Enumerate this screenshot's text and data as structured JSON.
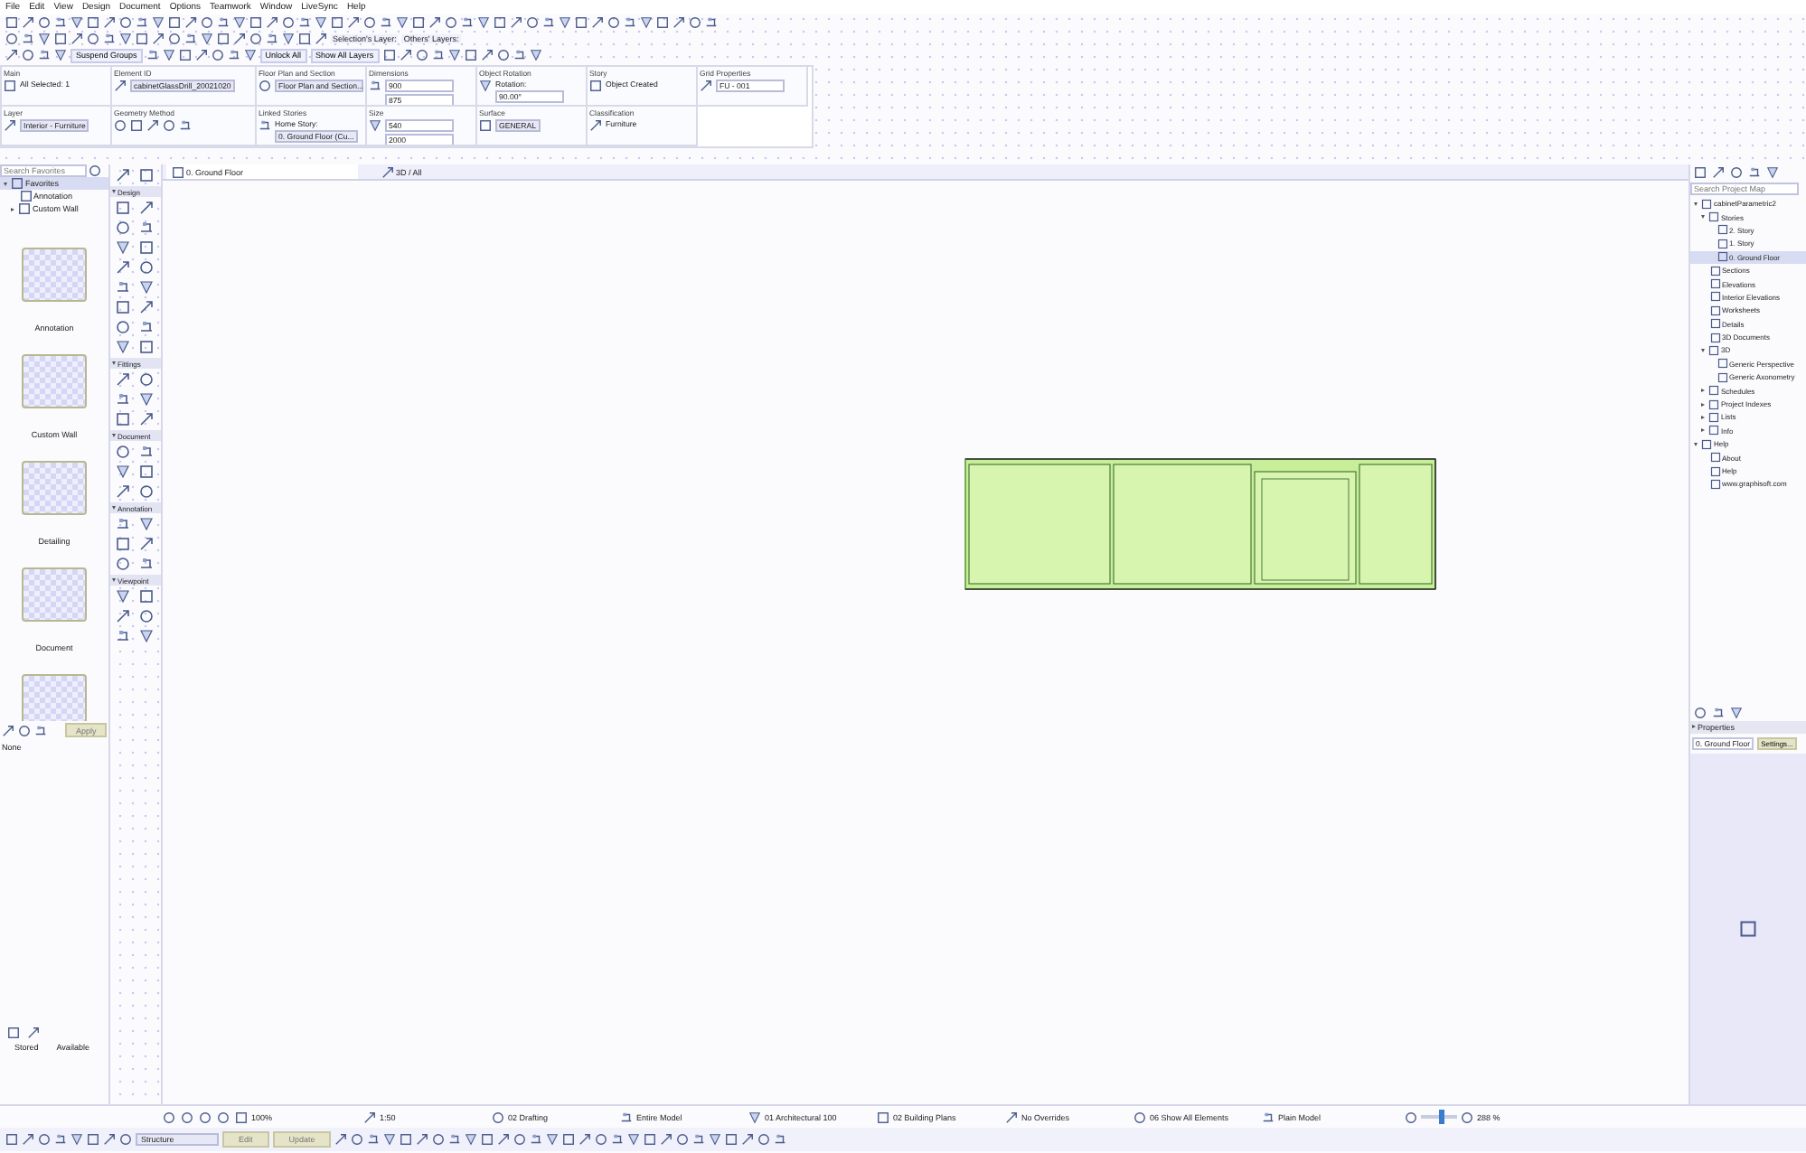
{
  "menu": [
    "File",
    "Edit",
    "View",
    "Design",
    "Document",
    "Options",
    "Teamwork",
    "Window",
    "LiveSync",
    "Help"
  ],
  "toolbar": {
    "selection_layer": "Selection's Layer:",
    "others_layers": "Others' Layers:",
    "suspend_groups": "Suspend Groups",
    "unlock_all": "Unlock All",
    "show_all_layers": "Show All Layers"
  },
  "info_box": {
    "top": [
      {
        "label": "Main",
        "items": [
          {
            "kind": "text",
            "text": "All Selected: 1"
          }
        ]
      },
      {
        "label": "Element ID",
        "items": [
          {
            "kind": "dropdown",
            "text": "cabinetGlassDrill_20021020"
          }
        ]
      },
      {
        "label": "Floor Plan and Section",
        "items": [
          {
            "kind": "dropdown",
            "text": "Floor Plan and Section..."
          }
        ]
      },
      {
        "label": "Dimensions",
        "items": [
          {
            "kind": "input",
            "text": "900"
          },
          {
            "kind": "input",
            "text": "875"
          }
        ]
      },
      {
        "label": "Object Rotation",
        "items": [
          {
            "kind": "text",
            "text": "Rotation:"
          },
          {
            "kind": "input",
            "text": "90.00°"
          }
        ]
      },
      {
        "label": "Story",
        "items": [
          {
            "kind": "text",
            "text": "Object Created"
          }
        ]
      },
      {
        "label": "Grid Properties",
        "items": [
          {
            "kind": "input",
            "text": "FU - 001"
          }
        ]
      }
    ],
    "bottom": [
      {
        "label": "Layer",
        "items": [
          {
            "kind": "dropdown",
            "text": "Interior - Furniture"
          }
        ]
      },
      {
        "label": "Geometry Method"
      },
      {
        "label": "Linked Stories",
        "items": [
          {
            "kind": "text",
            "text": "Home Story:"
          },
          {
            "kind": "dropdown",
            "text": "0. Ground Floor (Cu..."
          }
        ]
      },
      {
        "label": "Size",
        "items": [
          {
            "kind": "input",
            "text": "540"
          },
          {
            "kind": "input",
            "text": "2000"
          }
        ]
      },
      {
        "label": "Surface",
        "items": [
          {
            "kind": "dropdown",
            "text": "GENERAL"
          }
        ]
      },
      {
        "label": "Classification",
        "items": [
          {
            "kind": "text",
            "text": "Furniture"
          }
        ]
      }
    ]
  },
  "favorites": {
    "search": {
      "placeholder": "Search Favorites"
    },
    "tree": [
      {
        "label": "Favorites",
        "expanded": true,
        "selected": true,
        "children": [
          {
            "label": "Annotation",
            "selected": false
          },
          {
            "label": "Custom Wall",
            "expanded": false,
            "selected": false
          }
        ]
      }
    ],
    "previews": [
      {
        "kind": "labeled",
        "label": "Annotation"
      },
      {
        "kind": "labeled",
        "label": "Custom Wall"
      },
      {
        "kind": "labeled",
        "label": "Detailing"
      },
      {
        "kind": "labeled",
        "label": "Document"
      },
      {
        "kind": "unlabeled"
      }
    ],
    "apply": "Apply",
    "none_label": "None",
    "stored": "Stored",
    "available": "Available"
  },
  "toolbox": [
    {
      "title": "Design",
      "expanded": true
    },
    {
      "title": "Fittings",
      "expanded": true
    },
    {
      "title": "Document",
      "expanded": true
    },
    {
      "title": "Annotation",
      "expanded": true
    },
    {
      "title": "Viewpoint",
      "expanded": true
    }
  ],
  "view_tabs": [
    {
      "label": "0. Ground Floor",
      "selected": true
    },
    {
      "label": "3D / All",
      "selected": false
    }
  ],
  "project_map": {
    "search": {
      "placeholder": "Search Project Map"
    },
    "tree": [
      {
        "label": "cabinetParametric2",
        "expanded": true,
        "selected": false,
        "children": [
          {
            "label": "Stories",
            "expanded": true,
            "selected": false,
            "children": [
              {
                "label": "2. Story",
                "selected": false
              },
              {
                "label": "1. Story",
                "selected": false
              },
              {
                "label": "0. Ground Floor",
                "selected": true
              }
            ]
          },
          {
            "label": "Sections",
            "selected": false
          },
          {
            "label": "Elevations",
            "selected": false
          },
          {
            "label": "Interior Elevations",
            "selected": false
          },
          {
            "label": "Worksheets",
            "selected": false
          },
          {
            "label": "Details",
            "selected": false
          },
          {
            "label": "3D Documents",
            "selected": false
          },
          {
            "label": "3D",
            "expanded": true,
            "selected": false,
            "children": [
              {
                "label": "Generic Perspective",
                "selected": false
              },
              {
                "label": "Generic Axonometry",
                "selected": false
              }
            ]
          },
          {
            "label": "Schedules",
            "expanded": false,
            "selected": false
          },
          {
            "label": "Project Indexes",
            "expanded": false,
            "selected": false
          },
          {
            "label": "Lists",
            "expanded": false,
            "selected": false
          },
          {
            "label": "Info",
            "expanded": false,
            "selected": false
          }
        ]
      },
      {
        "label": "Help",
        "expanded": true,
        "selected": false,
        "children": [
          {
            "label": "About",
            "selected": false
          },
          {
            "label": "Help",
            "selected": false
          },
          {
            "label": "www.graphisoft.com",
            "selected": false
          }
        ]
      }
    ]
  },
  "properties": {
    "title": "Properties",
    "story": "0. Ground Floor",
    "button": "Settings..."
  },
  "status_bar": {
    "zoom": "100%",
    "scale": "1:50",
    "layer_combo": "02 Drafting",
    "model_view": "Entire Model",
    "pen_set": "01 Architectural 100",
    "mvo": "02 Building Plans",
    "overrides": "No Overrides",
    "renovation": "06 Show All Elements",
    "structure_display": "Plain Model",
    "zoom_level": {
      "level": 0.55
    },
    "zoom_percent": "288 %"
  },
  "edit_bar": {
    "structure": "Structure",
    "edit": "Edit",
    "update": "Update"
  }
}
